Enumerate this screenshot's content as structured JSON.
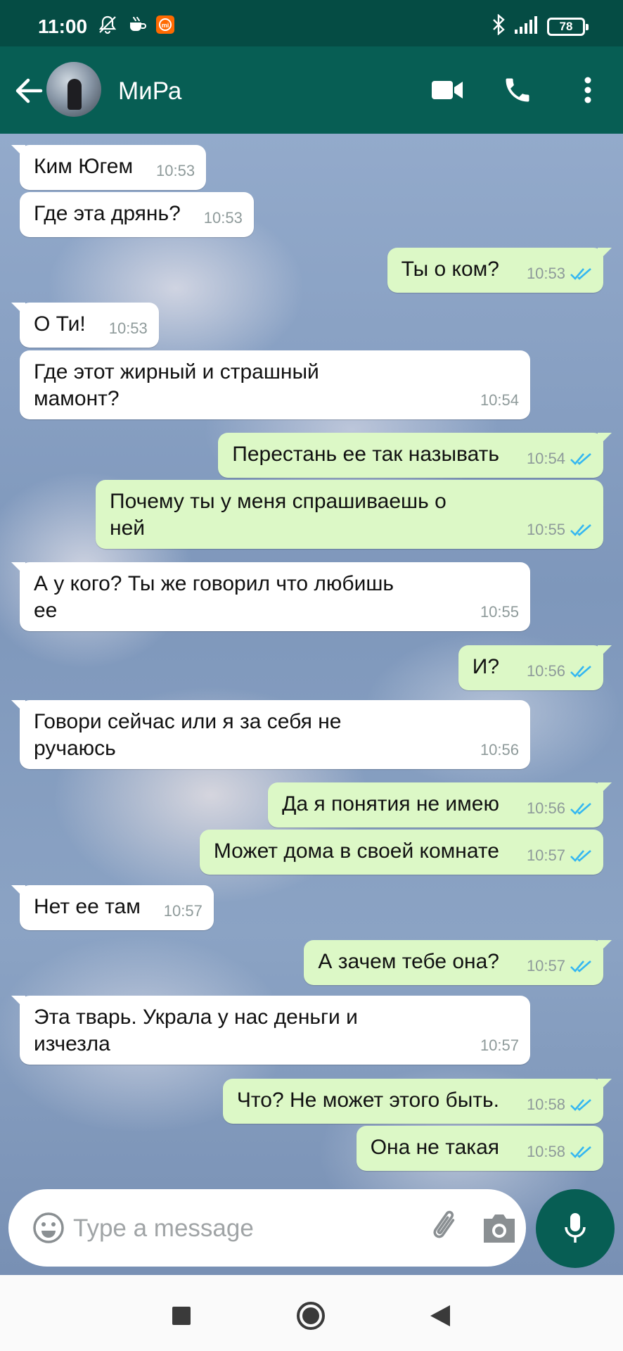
{
  "status_bar": {
    "time": "11:00",
    "battery": "78",
    "icons": [
      "mute-bell-icon",
      "coffee-icon",
      "mi-icon",
      "bluetooth-icon",
      "signal-icon",
      "battery-icon"
    ]
  },
  "header": {
    "contact_name": "МиРа",
    "icons": [
      "back-arrow-icon",
      "video-call-icon",
      "voice-call-icon",
      "more-vert-icon"
    ]
  },
  "messages": [
    {
      "dir": "in",
      "text": "Ким Югем",
      "time": "10:53"
    },
    {
      "dir": "in",
      "text": "Где эта дрянь?",
      "time": "10:53"
    },
    {
      "dir": "out",
      "text": "Ты о ком?",
      "time": "10:53"
    },
    {
      "dir": "in",
      "text": "О Ти!",
      "time": "10:53"
    },
    {
      "dir": "in",
      "text": "Где этот жирный и страшный\nмамонт?",
      "time": "10:54"
    },
    {
      "dir": "out",
      "text": "Перестань ее так называть",
      "time": "10:54"
    },
    {
      "dir": "out",
      "text": "Почему ты у меня спрашиваешь о\nней",
      "time": "10:55"
    },
    {
      "dir": "in",
      "text": "А у кого? Ты же говорил что любишь\nее",
      "time": "10:55"
    },
    {
      "dir": "out",
      "text": "И?",
      "time": "10:56"
    },
    {
      "dir": "in",
      "text": "Говори сейчас или я за себя не\nручаюсь",
      "time": "10:56"
    },
    {
      "dir": "out",
      "text": "Да я понятия не имею",
      "time": "10:56"
    },
    {
      "dir": "out",
      "text": "Может дома в своей комнате",
      "time": "10:57"
    },
    {
      "dir": "in",
      "text": "Нет ее там",
      "time": "10:57"
    },
    {
      "dir": "out",
      "text": "А зачем тебе она?",
      "time": "10:57"
    },
    {
      "dir": "in",
      "text": "Эта тварь. Украла у нас деньги и\nизчезла",
      "time": "10:57"
    },
    {
      "dir": "out",
      "text": "Что? Не может этого быть.",
      "time": "10:58"
    },
    {
      "dir": "out",
      "text": "Она не такая",
      "time": "10:58"
    }
  ],
  "composer": {
    "placeholder": "Type a message",
    "value": ""
  },
  "colors": {
    "header": "#075e54",
    "status_bar": "#054c44",
    "incoming_bubble": "#ffffff",
    "outgoing_bubble": "#dcf8c6",
    "read_ticks": "#34b7f1"
  }
}
